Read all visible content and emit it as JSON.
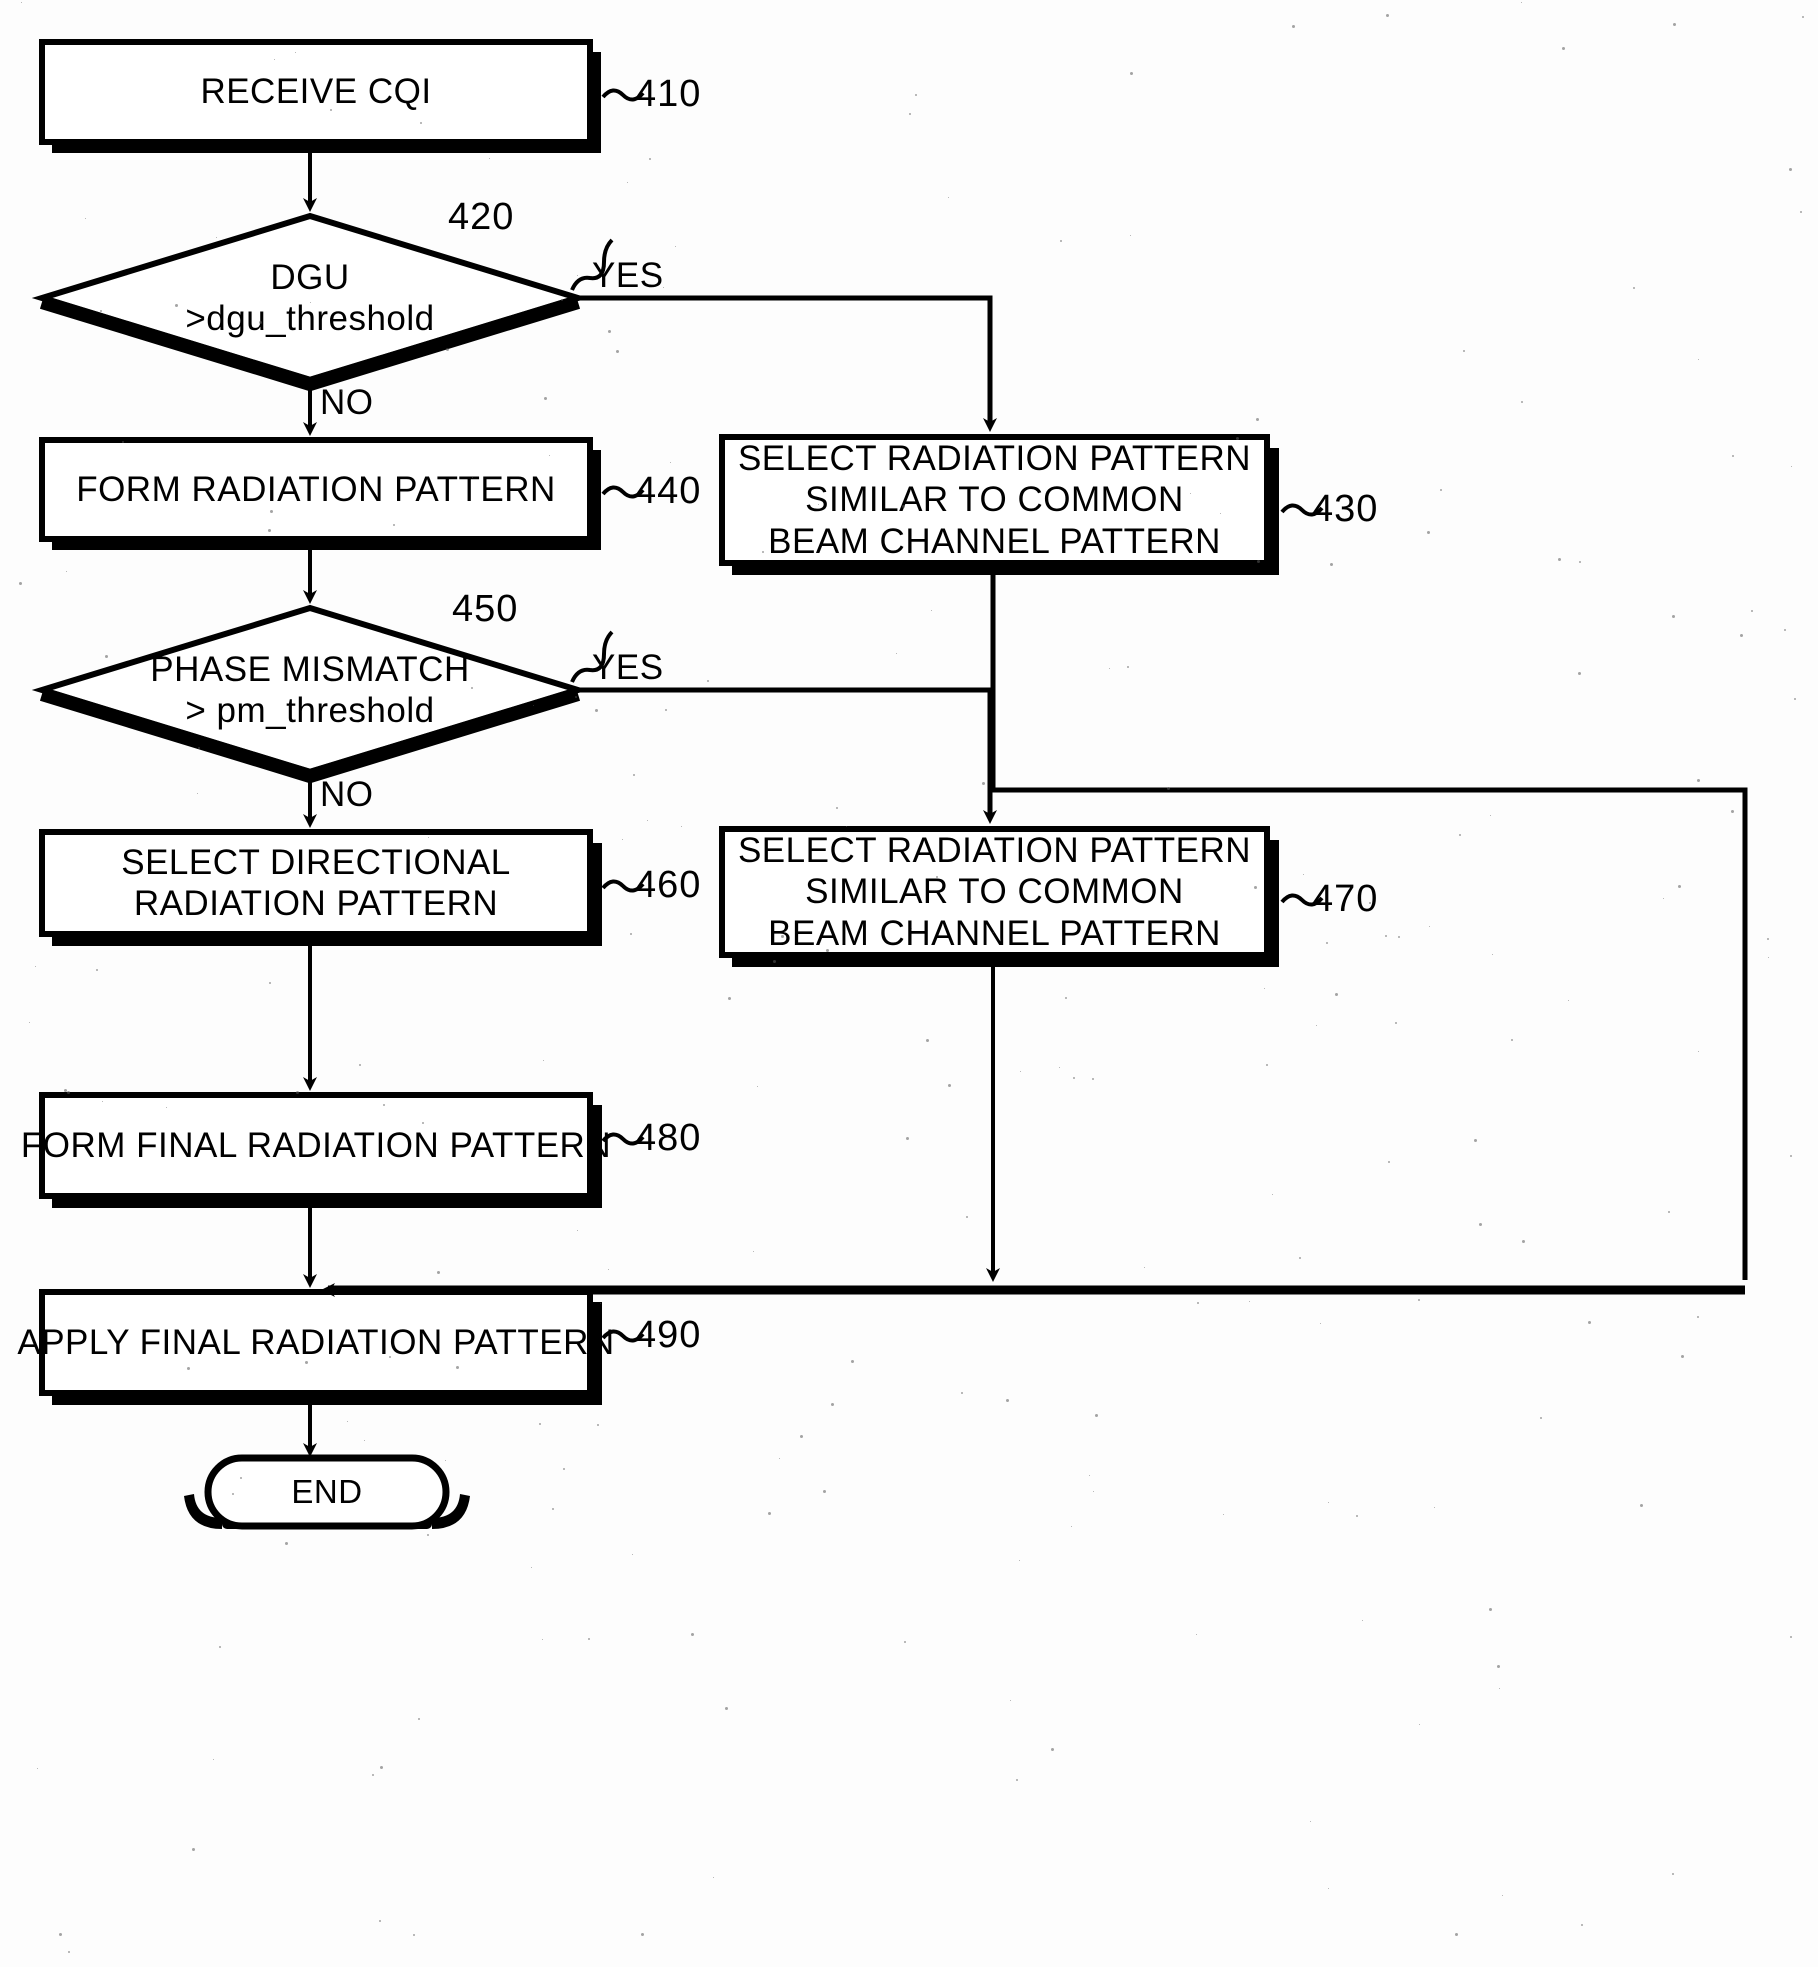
{
  "figure": {
    "type": "flowchart",
    "title": "",
    "background_color": "#fdfdfd",
    "line_color": "#000000"
  },
  "nodes": [
    {
      "id": "410",
      "shape": "process",
      "ref": "410",
      "lines": [
        "RECEIVE CQI"
      ]
    },
    {
      "id": "420",
      "shape": "decision",
      "ref": "420",
      "lines": [
        "DGU",
        ">dgu_threshold"
      ]
    },
    {
      "id": "430",
      "shape": "process",
      "ref": "430",
      "lines": [
        "SELECT RADIATION PATTERN",
        "SIMILAR TO COMMON",
        "BEAM CHANNEL PATTERN"
      ]
    },
    {
      "id": "440",
      "shape": "process",
      "ref": "440",
      "lines": [
        "FORM RADIATION PATTERN"
      ]
    },
    {
      "id": "450",
      "shape": "decision",
      "ref": "450",
      "lines": [
        "PHASE MISMATCH",
        "> pm_threshold"
      ]
    },
    {
      "id": "460",
      "shape": "process",
      "ref": "460",
      "lines": [
        "SELECT DIRECTIONAL",
        "RADIATION PATTERN"
      ]
    },
    {
      "id": "470",
      "shape": "process",
      "ref": "470",
      "lines": [
        "SELECT RADIATION PATTERN",
        "SIMILAR TO COMMON",
        "BEAM CHANNEL PATTERN"
      ]
    },
    {
      "id": "480",
      "shape": "process",
      "ref": "480",
      "lines": [
        "FORM FINAL RADIATION PATTERN"
      ]
    },
    {
      "id": "490",
      "shape": "process",
      "ref": "490",
      "lines": [
        "APPLY FINAL RADIATION PATTERN"
      ]
    },
    {
      "id": "end",
      "shape": "terminator",
      "ref": "",
      "lines": [
        "END"
      ]
    }
  ],
  "edge_labels": {
    "dgu_yes": "YES",
    "dgu_no": "NO",
    "pm_yes": "YES",
    "pm_no": "NO"
  },
  "refs": {
    "r410": "410",
    "r420": "420",
    "r430": "430",
    "r440": "440",
    "r450": "450",
    "r460": "460",
    "r470": "470",
    "r480": "480",
    "r490": "490"
  },
  "node_text": {
    "n410_l1": "RECEIVE CQI",
    "n420_l1": "DGU",
    "n420_l2": ">dgu_threshold",
    "n430_l1": "SELECT RADIATION PATTERN",
    "n430_l2": "SIMILAR TO COMMON",
    "n430_l3": "BEAM CHANNEL PATTERN",
    "n440_l1": "FORM RADIATION PATTERN",
    "n450_l1": "PHASE MISMATCH",
    "n450_l2": "> pm_threshold",
    "n460_l1": "SELECT DIRECTIONAL",
    "n460_l2": "RADIATION PATTERN",
    "n470_l1": "SELECT RADIATION PATTERN",
    "n470_l2": "SIMILAR TO COMMON",
    "n470_l3": "BEAM CHANNEL PATTERN",
    "n480_l1": "FORM FINAL RADIATION PATTERN",
    "n490_l1": "APPLY FINAL RADIATION PATTERN",
    "nend_l1": "END"
  }
}
